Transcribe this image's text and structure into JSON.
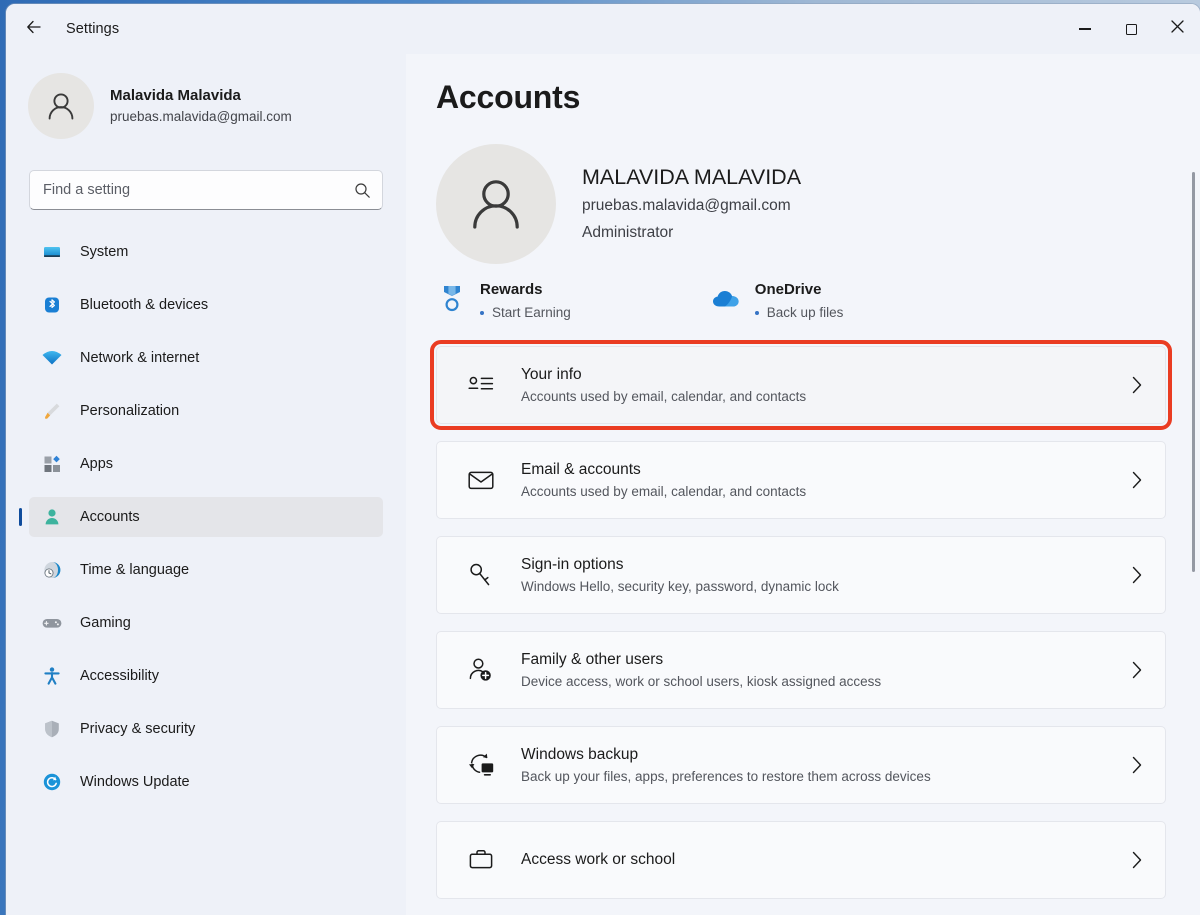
{
  "window": {
    "title": "Settings",
    "back_icon": "arrow-left-icon",
    "controls": {
      "minimize": "minimize-icon",
      "maximize": "maximize-icon",
      "close": "close-icon"
    }
  },
  "sidebar": {
    "profile": {
      "name": "Malavida Malavida",
      "email": "pruebas.malavida@gmail.com",
      "avatar_icon": "person-avatar-icon"
    },
    "search": {
      "placeholder": "Find a setting",
      "value": "",
      "icon": "search-icon"
    },
    "items": [
      {
        "label": "System",
        "icon": "monitor-icon",
        "selected": false,
        "color": "#27a7e5"
      },
      {
        "label": "Bluetooth & devices",
        "icon": "bluetooth-icon",
        "selected": false,
        "color": "#1a7fd4"
      },
      {
        "label": "Network & internet",
        "icon": "wifi-icon",
        "selected": false,
        "color": "#1b93d8"
      },
      {
        "label": "Personalization",
        "icon": "paintbrush-icon",
        "selected": false,
        "color": "#e8a33d"
      },
      {
        "label": "Apps",
        "icon": "apps-grid-icon",
        "selected": false,
        "color": "#6b6f76"
      },
      {
        "label": "Accounts",
        "icon": "person-icon",
        "selected": true,
        "color": "#3db39e"
      },
      {
        "label": "Time & language",
        "icon": "clock-globe-icon",
        "selected": false,
        "color": "#1a87c9"
      },
      {
        "label": "Gaming",
        "icon": "gamepad-icon",
        "selected": false,
        "color": "#7d828b"
      },
      {
        "label": "Accessibility",
        "icon": "accessibility-icon",
        "selected": false,
        "color": "#1f7fc4"
      },
      {
        "label": "Privacy & security",
        "icon": "shield-icon",
        "selected": false,
        "color": "#9aa0aa"
      },
      {
        "label": "Windows Update",
        "icon": "update-refresh-icon",
        "selected": false,
        "color": "#1b93d8"
      }
    ]
  },
  "main": {
    "page_title": "Accounts",
    "account": {
      "name": "MALAVIDA MALAVIDA",
      "email": "pruebas.malavida@gmail.com",
      "role": "Administrator",
      "avatar_icon": "person-avatar-icon"
    },
    "quick_links": [
      {
        "title": "Rewards",
        "sub": "Start Earning",
        "icon": "rewards-medal-icon"
      },
      {
        "title": "OneDrive",
        "sub": "Back up files",
        "icon": "onedrive-cloud-icon"
      }
    ],
    "cards": [
      {
        "title": "Your info",
        "sub": "Accounts used by email, calendar, and contacts",
        "icon": "contact-card-icon",
        "highlighted": true
      },
      {
        "title": "Email & accounts",
        "sub": "Accounts used by email, calendar, and contacts",
        "icon": "envelope-icon",
        "highlighted": false
      },
      {
        "title": "Sign-in options",
        "sub": "Windows Hello, security key, password, dynamic lock",
        "icon": "key-icon",
        "highlighted": false
      },
      {
        "title": "Family & other users",
        "sub": "Device access, work or school users, kiosk assigned access",
        "icon": "person-add-icon",
        "highlighted": false
      },
      {
        "title": "Windows backup",
        "sub": "Back up your files, apps, preferences to restore them across devices",
        "icon": "backup-pc-icon",
        "highlighted": false
      },
      {
        "title": "Access work or school",
        "sub": "",
        "icon": "briefcase-icon",
        "highlighted": false
      }
    ],
    "chevron_icon": "chevron-right-icon"
  },
  "colors": {
    "highlight_border": "#ea3c22",
    "accent_bar": "#0f4c9c",
    "sidebar_bg": "#eef1f8",
    "content_bg": "#f3f5fa",
    "card_bg": "#f9fafc"
  }
}
